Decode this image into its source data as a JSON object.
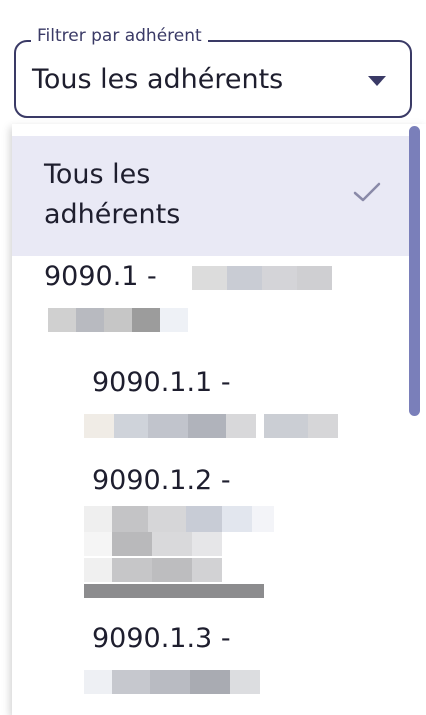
{
  "filter": {
    "label": "Filtrer par adhérent",
    "value": "Tous les adhérents"
  },
  "options": [
    {
      "line1": "Tous les",
      "line2": "adhérents",
      "selected": true
    },
    {
      "line1": "9090.1 -"
    },
    {
      "line1": "9090.1.1 -"
    },
    {
      "line1": "9090.1.2 -"
    },
    {
      "line1": "9090.1.3 -"
    }
  ],
  "colors": {
    "border": "#3a3a66",
    "selected_bg": "#e9e9f5",
    "scrollbar": "#7a7fba",
    "text": "#1e1e2e"
  },
  "icons": [
    "chevron-down-icon",
    "check-icon"
  ]
}
